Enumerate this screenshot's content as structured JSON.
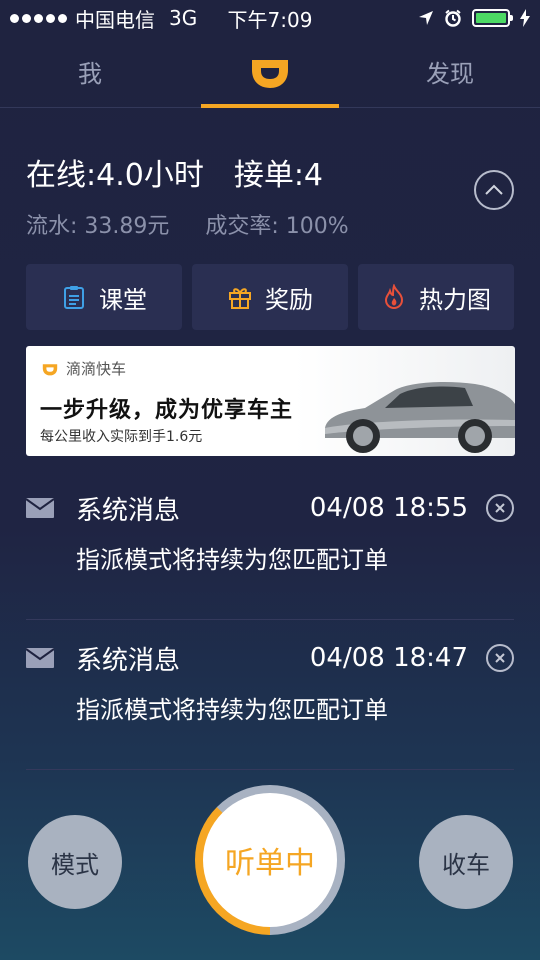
{
  "status_bar": {
    "carrier": "中国电信",
    "network": "3G",
    "time": "下午7:09"
  },
  "tabs": [
    {
      "label": "我"
    },
    {
      "label": "",
      "icon": "didi-logo-icon",
      "active": true
    },
    {
      "label": "发现"
    }
  ],
  "stats": {
    "online": "在线:4.0小时",
    "orders": "接单:4",
    "income": "流水: 33.89元",
    "rate": "成交率: 100%"
  },
  "shortcuts": [
    {
      "label": "课堂",
      "icon": "clipboard-icon",
      "color": "#3fa0e6"
    },
    {
      "label": "奖励",
      "icon": "gift-icon",
      "color": "#f5a623"
    },
    {
      "label": "热力图",
      "icon": "flame-icon",
      "color": "#e8503a"
    }
  ],
  "banner": {
    "brand": "滴滴快车",
    "headline": "一步升级，成为优享车主",
    "subline": "每公里收入实际到手1.6元"
  },
  "messages": [
    {
      "title": "系统消息",
      "time": "04/08 18:55",
      "body": "指派模式将持续为您匹配订单"
    },
    {
      "title": "系统消息",
      "time": "04/08 18:47",
      "body": "指派模式将持续为您匹配订单"
    }
  ],
  "controls": {
    "mode_label": "模式",
    "listen_label": "听单中",
    "stop_label": "收车"
  },
  "colors": {
    "accent": "#f5a623",
    "background": "#1f2340"
  }
}
